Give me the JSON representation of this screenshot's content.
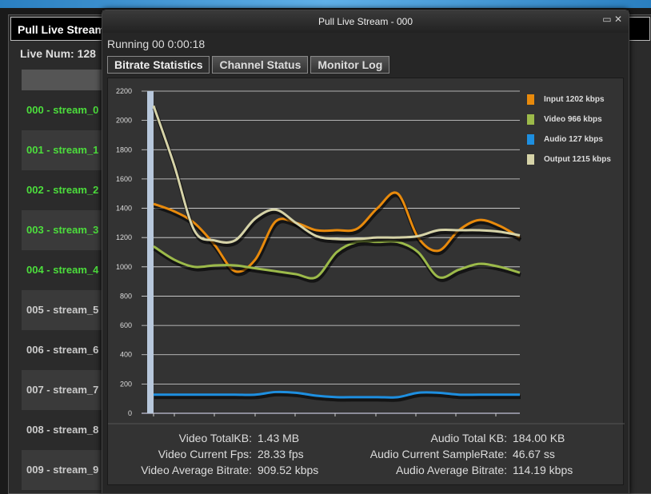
{
  "background_window": {
    "title": "Pull Live Stream",
    "live_num": "Live Num: 128",
    "streams": [
      {
        "label": "000 - stream_0",
        "active": true
      },
      {
        "label": "001 - stream_1",
        "active": true
      },
      {
        "label": "002 - stream_2",
        "active": true
      },
      {
        "label": "003 - stream_3",
        "active": true
      },
      {
        "label": "004 - stream_4",
        "active": true
      },
      {
        "label": "005 - stream_5",
        "active": false
      },
      {
        "label": "006 - stream_6",
        "active": false
      },
      {
        "label": "007 - stream_7",
        "active": false
      },
      {
        "label": "008 - stream_8",
        "active": false
      },
      {
        "label": "009 - stream_9",
        "active": false
      }
    ]
  },
  "dialog": {
    "title": "Pull Live Stream - 000",
    "status": "Running",
    "elapsed": "00 0:00:18",
    "tabs": [
      {
        "label": "Bitrate Statistics",
        "active": true
      },
      {
        "label": "Channel Status",
        "active": false
      },
      {
        "label": "Monitor Log",
        "active": false
      }
    ]
  },
  "chart_data": {
    "type": "line",
    "ylim": [
      0,
      2200
    ],
    "yticks": [
      0,
      200,
      400,
      600,
      800,
      1000,
      1200,
      1400,
      1600,
      1800,
      2000,
      2200
    ],
    "grid": true,
    "legend": "right",
    "x": [
      0,
      1,
      2,
      3,
      4,
      5,
      6,
      7,
      8,
      9,
      10,
      11,
      12,
      13,
      14,
      15,
      16,
      17,
      18
    ],
    "series": [
      {
        "name": "Input 1202 kbps",
        "color": "#e88a0c",
        "values": [
          1430,
          1380,
          1300,
          1150,
          970,
          1050,
          1310,
          1300,
          1250,
          1250,
          1260,
          1400,
          1500,
          1200,
          1110,
          1250,
          1320,
          1280,
          1200
        ]
      },
      {
        "name": "Video 966 kbps",
        "color": "#9cba4a",
        "values": [
          1140,
          1050,
          1000,
          1010,
          1010,
          990,
          970,
          950,
          930,
          1100,
          1170,
          1170,
          1170,
          1100,
          930,
          980,
          1020,
          1000,
          960
        ]
      },
      {
        "name": "Audio 127 kbps",
        "color": "#1e8fe0",
        "values": [
          127,
          127,
          127,
          127,
          127,
          127,
          145,
          140,
          120,
          110,
          110,
          110,
          110,
          140,
          140,
          127,
          127,
          127,
          127
        ]
      },
      {
        "name": "Output 1215 kbps",
        "color": "#d6d3a8",
        "values": [
          2100,
          1700,
          1250,
          1180,
          1180,
          1330,
          1390,
          1300,
          1210,
          1190,
          1190,
          1200,
          1200,
          1210,
          1250,
          1250,
          1250,
          1240,
          1215
        ]
      }
    ]
  },
  "stats": {
    "left": [
      {
        "label": "Video TotalKB:",
        "value": "1.43 MB"
      },
      {
        "label": "Video Current Fps:",
        "value": "28.33 fps"
      },
      {
        "label": "Video Average Bitrate:",
        "value": "909.52 kbps"
      }
    ],
    "right": [
      {
        "label": "Audio Total KB:",
        "value": "184.00 KB"
      },
      {
        "label": "Audio Current SampleRate:",
        "value": "46.67 ss"
      },
      {
        "label": "Audio Average Bitrate:",
        "value": "114.19 kbps"
      }
    ]
  }
}
